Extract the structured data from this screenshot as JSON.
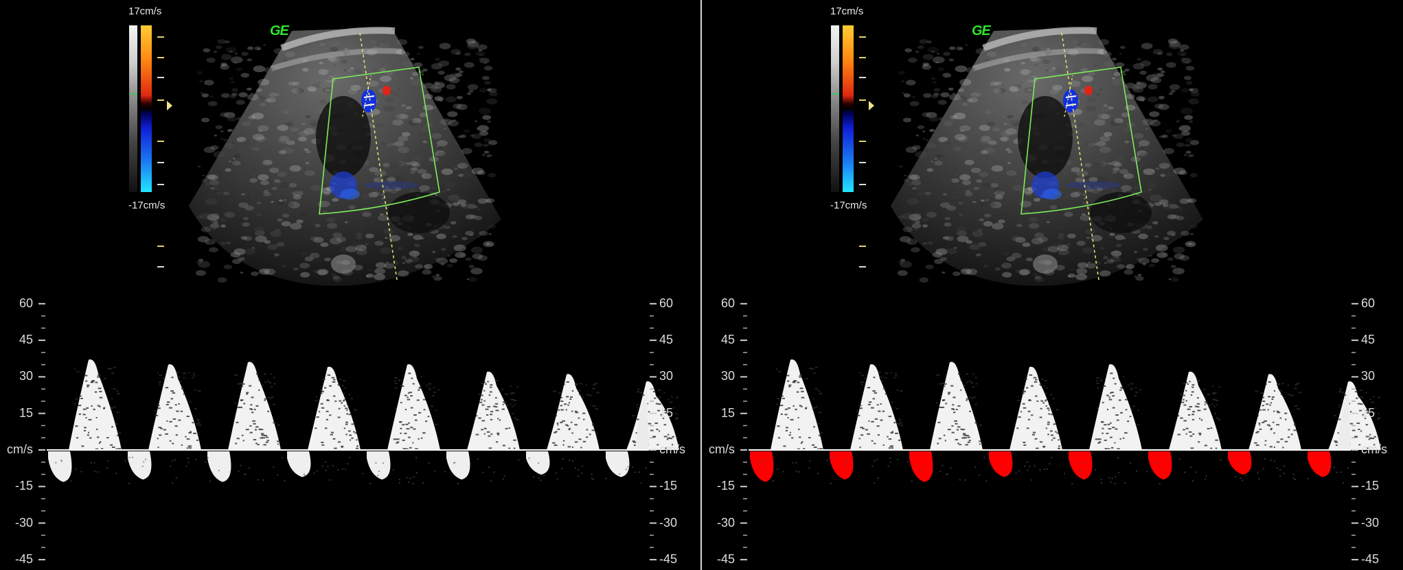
{
  "colorbar": {
    "top_label": "17cm/s",
    "bottom_label": "-17cm/s"
  },
  "logo": "GE",
  "doppler_axis": {
    "left_labels": [
      "60",
      "45",
      "30",
      "15",
      "cm/s",
      "-15",
      "-30",
      "-45"
    ],
    "right_labels": [
      "60",
      "45",
      "30",
      "15",
      "cm/s",
      "-15",
      "-30",
      "-45"
    ],
    "range_cm_s": [
      -45,
      60
    ],
    "unit": "cm/s"
  },
  "panels": [
    {
      "name": "original",
      "annotation": "none"
    },
    {
      "name": "segmented",
      "annotation": "reverse-flow waves highlighted",
      "annotation_color": "#ff0000"
    }
  ],
  "waveform": {
    "cycles": 8,
    "peak_forward_cm_s": [
      37,
      35,
      36,
      34,
      35,
      32,
      31,
      28
    ],
    "reverse_trough_cm_s": [
      -12,
      -11,
      -12,
      -10,
      -11,
      -11,
      -9,
      -10
    ]
  },
  "colors": {
    "background": "#000000",
    "roi_box": "#7cf05a",
    "cursor_line": "#e8e070",
    "segmentation": "#ff0000"
  }
}
